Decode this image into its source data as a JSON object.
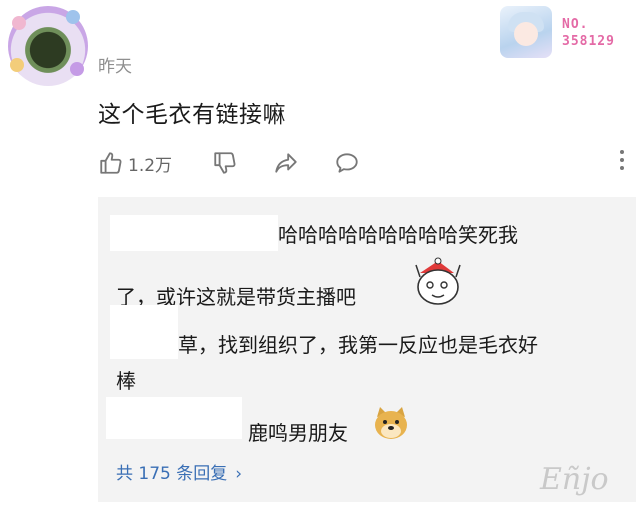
{
  "comment": {
    "timestamp": "昨天",
    "text": "这个毛衣有链接嘛",
    "like_count": "1.2万"
  },
  "badge": {
    "line1": "NO.",
    "line2": "358129"
  },
  "icons": {
    "like": "thumbs-up-icon",
    "dislike": "thumbs-down-icon",
    "share": "share-icon",
    "reply": "comment-icon",
    "more": "more-vertical-icon"
  },
  "replies": [
    {
      "text": "哈哈哈哈哈哈哈哈哈笑死我"
    },
    {
      "text": "了，或许这就是带货主播吧"
    },
    {
      "text": "草，找到组织了，我第一反应也是毛衣好"
    },
    {
      "text": "棒"
    },
    {
      "text": "鹿鸣男朋友"
    }
  ],
  "more_replies_label": "共 175 条回复",
  "colors": {
    "link": "#3a6fb5",
    "box_bg": "#f3f3f3",
    "badge": "#e46aa6"
  }
}
